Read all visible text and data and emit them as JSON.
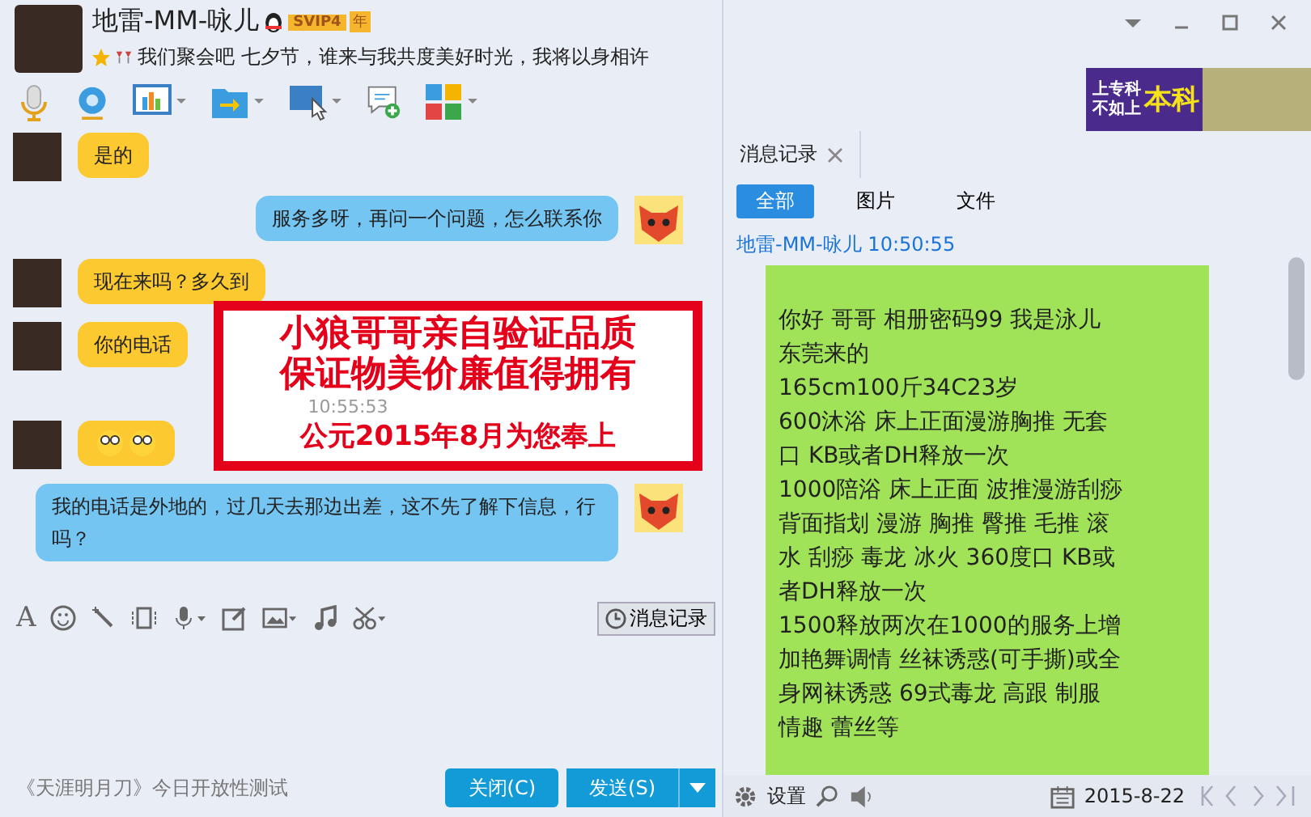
{
  "window": {
    "title": "地雷-MM-咏儿",
    "vip_badge": "SVIP4",
    "year_badge": "年",
    "status": "我们聚会吧 七夕节，谁来与我共度美好时光，我将以身相许"
  },
  "ad": {
    "line_1": "上专科",
    "line_2": "不如上",
    "highlight": "本科"
  },
  "messages": [
    {
      "kind": "received",
      "text": "是的"
    },
    {
      "kind": "sent",
      "text": "服务多呀，再问一个问题，怎么联系你"
    },
    {
      "kind": "received",
      "text": "现在来吗？多久到"
    },
    {
      "kind": "received",
      "text": "你的电话"
    },
    {
      "kind": "time",
      "text": "10:55:53"
    },
    {
      "kind": "sticker"
    },
    {
      "kind": "sent",
      "text": "我的电话是外地的，过几天去那边出差，这不先了解下信息，行吗？"
    }
  ],
  "font_icon": "A",
  "stamp": {
    "lines": [
      "小狼哥哥亲自验证品质",
      "保证物美价廉值得拥有",
      "公元2015年8月为您奉上"
    ]
  },
  "history_button": "消息记录",
  "footer": {
    "promo": "《天涯明月刀》今日开放性测试",
    "close": "关闭(C)",
    "send": "发送(S)"
  },
  "history": {
    "tab": "消息记录",
    "filters": [
      {
        "label": "全部",
        "selected": true
      },
      {
        "label": "图片",
        "selected": false
      },
      {
        "label": "文件",
        "selected": false
      }
    ],
    "sender": "地雷-MM-咏儿 10:50:55",
    "lines": [
      "你好 哥哥 相册密码99 我是泳儿",
      "东莞来的",
      "165cm100斤34C23岁",
      "600沐浴 床上正面漫游胸推 无套",
      "口 KB或者DH释放一次",
      "1000陪浴 床上正面 波推漫游刮痧",
      "背面指划 漫游 胸推 臀推 毛推 滚",
      "水 刮痧 毒龙 冰火 360度口 KB或",
      "者DH释放一次",
      "1500释放两次在1000的服务上增",
      "加艳舞调情 丝袜诱惑(可手撕)或全",
      "身网袜诱惑 69式毒龙 高跟 制服",
      "情趣 蕾丝等"
    ],
    "settings": "设置",
    "date": "2015-8-22"
  }
}
